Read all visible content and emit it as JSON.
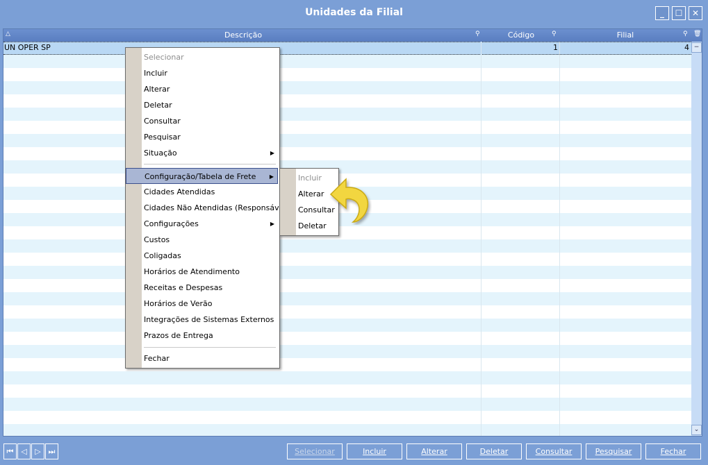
{
  "window": {
    "title": "Unidades da Filial",
    "minimize_icon": "minimize-icon",
    "maximize_icon": "maximize-icon",
    "close_icon": "close-icon"
  },
  "grid": {
    "columns": [
      {
        "label": "Descrição"
      },
      {
        "label": "Código"
      },
      {
        "label": "Filial"
      }
    ],
    "rows": [
      {
        "descricao": "UN OPER SP",
        "codigo": "1",
        "filial": "4"
      }
    ]
  },
  "context_menu": {
    "items": [
      {
        "label": "Selecionar",
        "disabled": true
      },
      {
        "label": "Incluir"
      },
      {
        "label": "Alterar"
      },
      {
        "label": "Deletar"
      },
      {
        "label": "Consultar"
      },
      {
        "label": "Pesquisar"
      },
      {
        "label": "Situação",
        "submenu": true
      },
      {
        "label": "Configuração/Tabela de Frete",
        "submenu": true,
        "highlighted": true
      },
      {
        "label": "Cidades Atendidas"
      },
      {
        "label": "Cidades Não Atendidas (Responsável)"
      },
      {
        "label": "Configurações",
        "submenu": true
      },
      {
        "label": "Custos"
      },
      {
        "label": "Coligadas"
      },
      {
        "label": "Horários de Atendimento"
      },
      {
        "label": "Receitas e Despesas"
      },
      {
        "label": "Horários de Verão"
      },
      {
        "label": "Integrações de Sistemas Externos"
      },
      {
        "label": "Prazos de Entrega"
      },
      {
        "label": "Fechar"
      }
    ]
  },
  "submenu": {
    "items": [
      {
        "label": "Incluir",
        "disabled": true
      },
      {
        "label": "Alterar"
      },
      {
        "label": "Consultar"
      },
      {
        "label": "Deletar"
      }
    ]
  },
  "bottom_bar": {
    "nav": [
      "first-icon",
      "prev-icon",
      "next-icon",
      "last-icon"
    ],
    "buttons": [
      {
        "label": "Selecionar",
        "disabled": true
      },
      {
        "label": "Incluir"
      },
      {
        "label": "Alterar"
      },
      {
        "label": "Deletar"
      },
      {
        "label": "Consultar"
      },
      {
        "label": "Pesquisar"
      },
      {
        "label": "Fechar"
      }
    ]
  },
  "colors": {
    "window_bg": "#7b9fd6",
    "header_bg": "#5a7ec0",
    "row_alt": "#e4f4fc",
    "row_selected": "#b9d8f4",
    "menu_highlight": "#a9b6d4",
    "arrow_yellow": "#f2d640"
  }
}
